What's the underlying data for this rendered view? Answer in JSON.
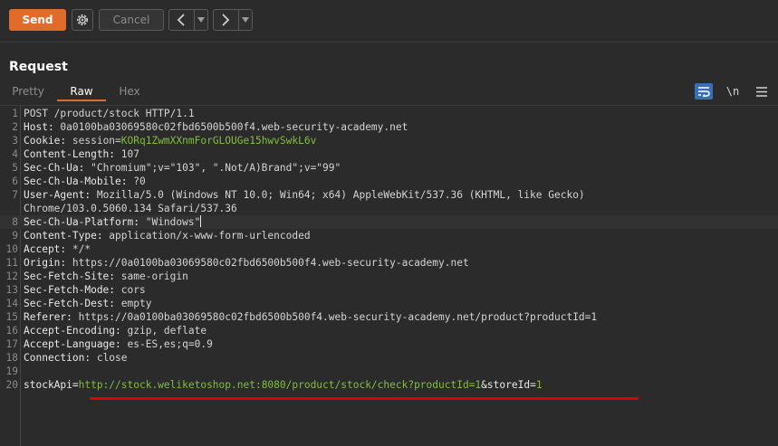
{
  "toolbar": {
    "send_label": "Send",
    "cancel_label": "Cancel",
    "settings_icon": "gear-icon",
    "back_icon": "chevron-left-icon",
    "forward_icon": "chevron-right-icon",
    "dropdown_icon": "caret-down-icon"
  },
  "panel": {
    "title": "Request",
    "tabs": [
      {
        "label": "Pretty",
        "active": false
      },
      {
        "label": "Raw",
        "active": true
      },
      {
        "label": "Hex",
        "active": false
      }
    ],
    "icons": {
      "wrap": "word-wrap-icon",
      "newline_label": "\\n",
      "menu": "hamburger-menu-icon"
    }
  },
  "colors": {
    "accent": "#e06b2b",
    "header_key": "#e8e8e8",
    "cookie_value": "#7fbf3f",
    "url_value": "#7fbf3f",
    "underline": "#e00000"
  },
  "request_lines": [
    {
      "n": "1",
      "key": "",
      "sep": "",
      "val": "POST /product/stock HTTP/1.1"
    },
    {
      "n": "2",
      "key": "Host",
      "sep": ": ",
      "val": "0a0100ba03069580c02fbd6500b500f4.web-security-academy.net"
    },
    {
      "n": "3",
      "key": "Cookie",
      "sep": ": ",
      "val": "session=",
      "extra": "KORq1ZwmXXnmForGLOUGe15hwvSwkL6v"
    },
    {
      "n": "4",
      "key": "Content-Length",
      "sep": ": ",
      "val": "107"
    },
    {
      "n": "5",
      "key": "Sec-Ch-Ua",
      "sep": ": ",
      "val": "\"Chromium\";v=\"103\", \".Not/A)Brand\";v=\"99\""
    },
    {
      "n": "6",
      "key": "Sec-Ch-Ua-Mobile",
      "sep": ": ",
      "val": "?0"
    },
    {
      "n": "7",
      "key": "User-Agent",
      "sep": ": ",
      "val": "Mozilla/5.0 (Windows NT 10.0; Win64; x64) AppleWebKit/537.36 (KHTML, like Gecko)"
    },
    {
      "n": "",
      "key": "",
      "sep": "",
      "val": "Chrome/103.0.5060.134 Safari/537.36"
    },
    {
      "n": "8",
      "key": "Sec-Ch-Ua-Platform",
      "sep": ": ",
      "val": "\"Windows\""
    },
    {
      "n": "9",
      "key": "Content-Type",
      "sep": ": ",
      "val": "application/x-www-form-urlencoded"
    },
    {
      "n": "10",
      "key": "Accept",
      "sep": ": ",
      "val": "*/*"
    },
    {
      "n": "11",
      "key": "Origin",
      "sep": ": ",
      "val": "https://0a0100ba03069580c02fbd6500b500f4.web-security-academy.net"
    },
    {
      "n": "12",
      "key": "Sec-Fetch-Site",
      "sep": ": ",
      "val": "same-origin"
    },
    {
      "n": "13",
      "key": "Sec-Fetch-Mode",
      "sep": ": ",
      "val": "cors"
    },
    {
      "n": "14",
      "key": "Sec-Fetch-Dest",
      "sep": ": ",
      "val": "empty"
    },
    {
      "n": "15",
      "key": "Referer",
      "sep": ": ",
      "val": "https://0a0100ba03069580c02fbd6500b500f4.web-security-academy.net/product?productId=1"
    },
    {
      "n": "16",
      "key": "Accept-Encoding",
      "sep": ": ",
      "val": "gzip, deflate"
    },
    {
      "n": "17",
      "key": "Accept-Language",
      "sep": ": ",
      "val": "es-ES,es;q=0.9"
    },
    {
      "n": "18",
      "key": "Connection",
      "sep": ": ",
      "val": "close"
    },
    {
      "n": "19",
      "key": "",
      "sep": "",
      "val": ""
    },
    {
      "n": "20",
      "key": "stockApi",
      "sep": "=",
      "val": "http://stock.weliketoshop.net:8080/product/stock/check?productId=1&storeId=1"
    }
  ]
}
